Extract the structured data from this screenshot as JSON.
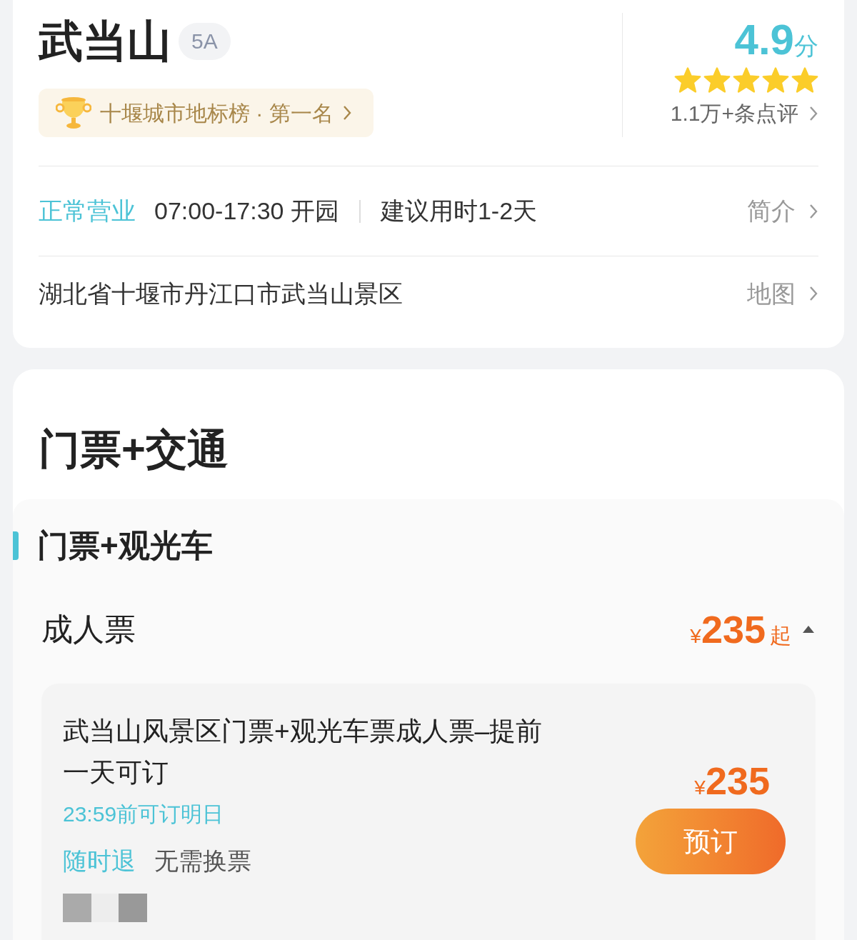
{
  "header": {
    "title": "武当山",
    "grade": "5A",
    "ranking": "十堰城市地标榜 · 第一名",
    "score": "4.9",
    "score_unit": "分",
    "stars": 5,
    "reviews": "1.1万+条点评"
  },
  "hours": {
    "status": "正常营业",
    "time": "07:00-17:30 开园",
    "duration": "建议用时1-2天",
    "link": "简介"
  },
  "address": {
    "text": "湖北省十堰市丹江口市武当山景区",
    "link": "地图"
  },
  "section_title": "门票+交通",
  "category": {
    "title": "门票+观光车"
  },
  "ticket_group": {
    "name": "成人票",
    "currency": "¥",
    "price": "235",
    "suffix": "起",
    "expanded": true
  },
  "products": [
    {
      "name": "武当山风景区门票+观光车票成人票–提前一天可订",
      "booking_note": "23:59前可订明日",
      "tags": [
        {
          "label": "随时退",
          "kind": "highlight"
        },
        {
          "label": "无需换票",
          "kind": "plain"
        }
      ],
      "currency": "¥",
      "price": "235",
      "button": "预订"
    }
  ]
}
